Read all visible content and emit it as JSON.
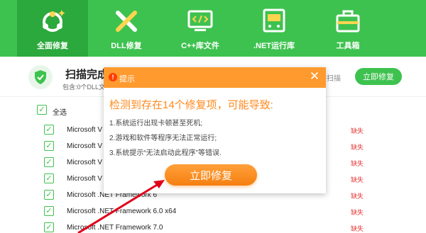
{
  "nav": {
    "tabs": [
      {
        "label": "全面修复",
        "icon": "full-repair-icon",
        "active": true
      },
      {
        "label": "DLL修复",
        "icon": "dll-repair-icon",
        "active": false
      },
      {
        "label": "C++库文件",
        "icon": "cpp-library-icon",
        "active": false
      },
      {
        "label": ".NET运行库",
        "icon": "dotnet-runtime-icon",
        "active": false
      },
      {
        "label": "工具箱",
        "icon": "toolbox-icon",
        "active": false
      }
    ]
  },
  "status": {
    "title": "扫描完成",
    "subtitle": "包含:0个DLL文",
    "rescan_label": "新扫描",
    "fix_button": "立即修复"
  },
  "list": {
    "select_all": "全选",
    "items": [
      {
        "name": "Microsoft V",
        "state": "缺失"
      },
      {
        "name": "Microsoft V",
        "state": "缺失"
      },
      {
        "name": "Microsoft V",
        "state": "缺失"
      },
      {
        "name": "Microsoft V",
        "state": "缺失"
      },
      {
        "name": "Microsoft .NET Framework 6",
        "state": "缺失"
      },
      {
        "name": "Microsoft .NET Framework 6.0 x64",
        "state": "缺失"
      },
      {
        "name": "Microsoft .NET Framework 7.0",
        "state": "缺失"
      }
    ]
  },
  "modal": {
    "title": "提示",
    "headline": "检测到存在14个修复项，可能导致:",
    "reasons": [
      "1.系统运行出现卡顿甚至死机;",
      "2.游戏和软件等程序无法正常运行;",
      "3.系统提示“无法启动此程序”等错误."
    ],
    "fix_button": "立即修复"
  },
  "colors": {
    "brand_green": "#3ec24f",
    "active_tab": "#2ca93d",
    "modal_orange": "#ff9a2e",
    "headline_orange": "#ff8a1f",
    "missing_red": "#e53935",
    "arrow_red": "#e0001a"
  }
}
